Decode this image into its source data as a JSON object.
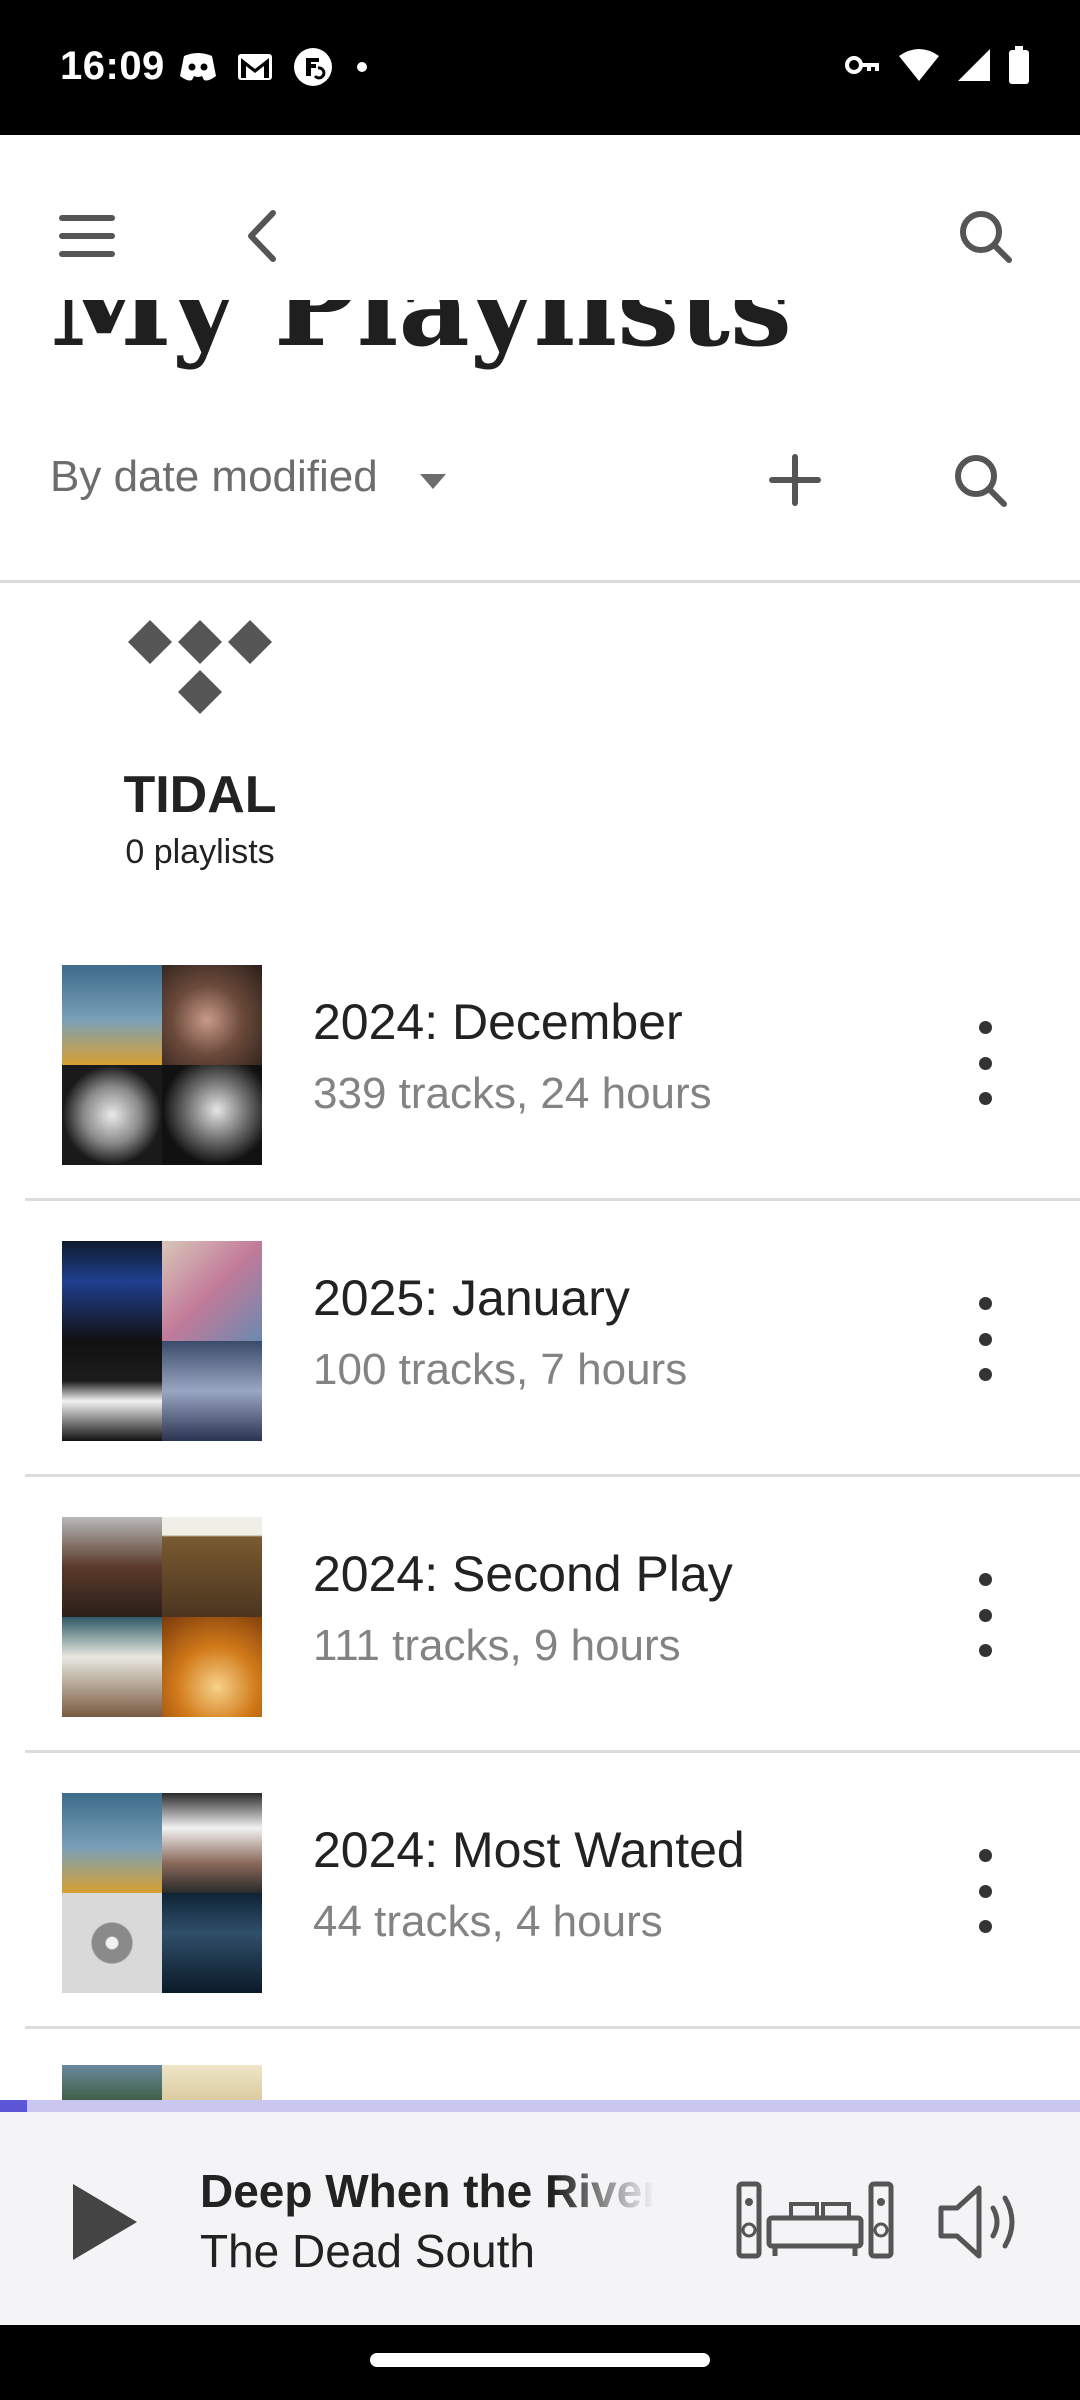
{
  "status_bar": {
    "time": "16:09",
    "left_icons": [
      "discord-icon",
      "gmail-icon",
      "sync-icon",
      "dot-icon"
    ],
    "right_icons": [
      "vpn-key-icon",
      "wifi-icon",
      "signal-icon",
      "battery-icon"
    ]
  },
  "app_bar": {
    "icons": [
      "menu-icon",
      "back-icon",
      "search-icon"
    ]
  },
  "header": {
    "title": "My Playlists"
  },
  "sort": {
    "label": "By date modified"
  },
  "tidal": {
    "name": "TIDAL",
    "count": "0 playlists"
  },
  "playlists": [
    {
      "name": "2024: December",
      "meta": "339 tracks, 24 hours",
      "art": [
        "#3d6b8a",
        "#6b4a3a",
        "#2a2a2a",
        "#1a1a1a"
      ]
    },
    {
      "name": "2025: January",
      "meta": "100 tracks, 7 hours",
      "art": [
        "#0f1a2e",
        "#c9b8c8",
        "#111111",
        "#3a4a6a"
      ]
    },
    {
      "name": "2024: Second Play",
      "meta": "111 tracks, 9 hours",
      "art": [
        "#5a3a2a",
        "#7a5a30",
        "#2f5a66",
        "#d27a1a"
      ]
    },
    {
      "name": "2024: Most Wanted",
      "meta": "44 tracks, 4 hours",
      "art": [
        "#3d6b8a",
        "#4a4a4a",
        "#d9d9d9",
        "#0e2436"
      ]
    }
  ],
  "now_playing": {
    "title": "Deep When the River",
    "artist": "The Dead South",
    "progress": 0.025,
    "colors": {
      "accent": "#5a56d6",
      "track": "#c9c6f0"
    }
  }
}
